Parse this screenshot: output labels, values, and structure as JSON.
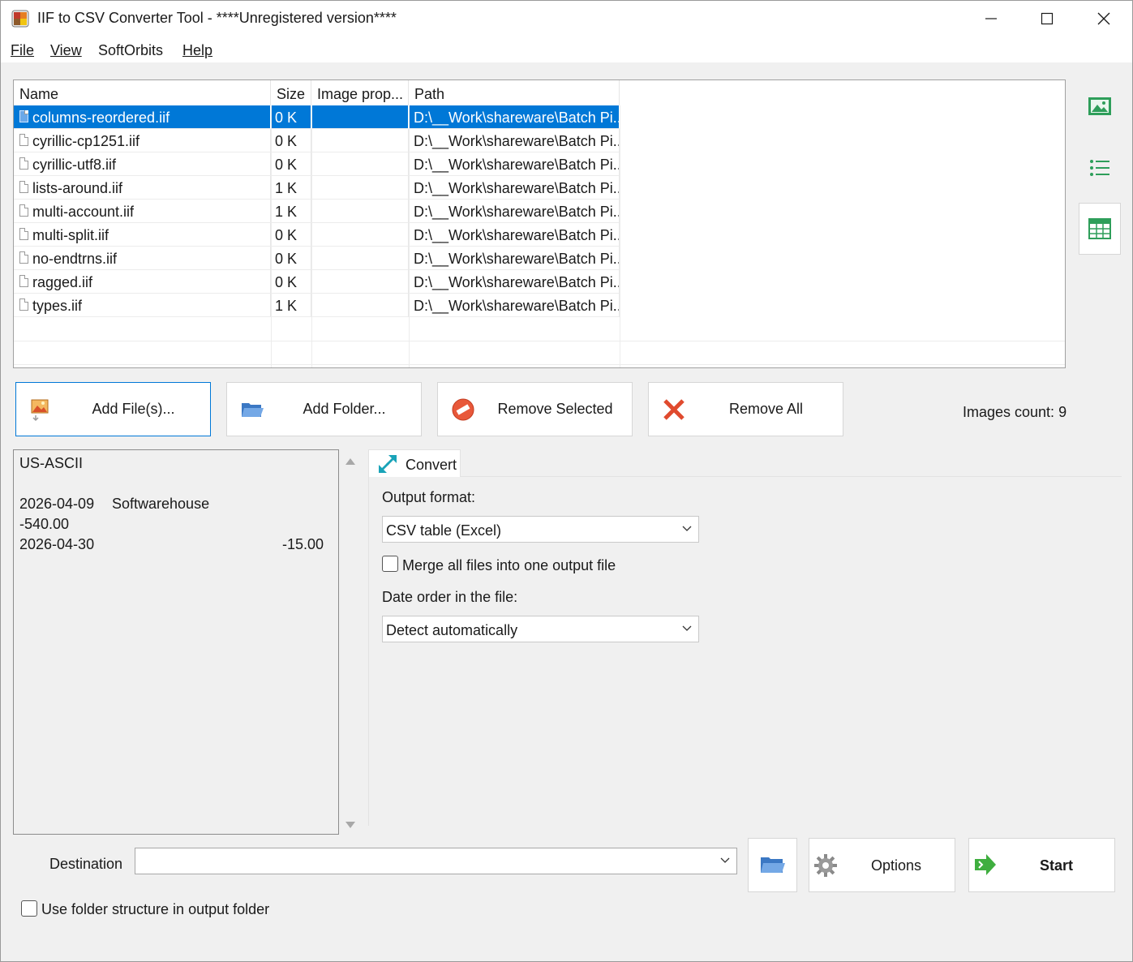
{
  "window": {
    "title": "IIF to CSV Converter Tool - ****Unregistered version****"
  },
  "menu": {
    "file": {
      "label": "File"
    },
    "view": {
      "label": "View"
    },
    "softorbits": {
      "label": "SoftOrbits"
    },
    "help": {
      "label": "Help"
    }
  },
  "filelist": {
    "columns": [
      "Name",
      "Size",
      "Image prop...",
      "Path"
    ],
    "rows": [
      {
        "name": "columns-reordered.iif",
        "size": "0 K",
        "prop": "",
        "path": "D:\\__Work\\shareware\\Batch Pi...",
        "selected": true
      },
      {
        "name": "cyrillic-cp1251.iif",
        "size": "0 K",
        "prop": "",
        "path": "D:\\__Work\\shareware\\Batch Pi..."
      },
      {
        "name": "cyrillic-utf8.iif",
        "size": "0 K",
        "prop": "",
        "path": "D:\\__Work\\shareware\\Batch Pi..."
      },
      {
        "name": "lists-around.iif",
        "size": "1 K",
        "prop": "",
        "path": "D:\\__Work\\shareware\\Batch Pi..."
      },
      {
        "name": "multi-account.iif",
        "size": "1 K",
        "prop": "",
        "path": "D:\\__Work\\shareware\\Batch Pi..."
      },
      {
        "name": "multi-split.iif",
        "size": "0 K",
        "prop": "",
        "path": "D:\\__Work\\shareware\\Batch Pi..."
      },
      {
        "name": "no-endtrns.iif",
        "size": "0 K",
        "prop": "",
        "path": "D:\\__Work\\shareware\\Batch Pi..."
      },
      {
        "name": "ragged.iif",
        "size": "0 K",
        "prop": "",
        "path": "D:\\__Work\\shareware\\Batch Pi..."
      },
      {
        "name": "types.iif",
        "size": "1 K",
        "prop": "",
        "path": "D:\\__Work\\shareware\\Batch Pi..."
      }
    ]
  },
  "actions": {
    "add_files": "Add File(s)...",
    "add_folder": "Add Folder...",
    "remove_selected": "Remove Selected",
    "remove_all": "Remove All",
    "images_count": "Images count: 9"
  },
  "preview": {
    "line1": "US-ASCII",
    "line2_date": "2026-04-09",
    "line2_name": "Softwarehouse",
    "line3": "-540.00",
    "line4_date": "2026-04-30",
    "line4_amount": "-15.00"
  },
  "convert_tab": {
    "tab_label": "Convert",
    "output_format_label": "Output format:",
    "output_format_value": "CSV table (Excel)",
    "merge_label": "Merge all files into one output file",
    "merge_checked": false,
    "date_order_label": "Date order in the file:",
    "date_order_value": "Detect automatically"
  },
  "bottom": {
    "destination_label": "Destination",
    "destination_value": "",
    "options_label": "Options",
    "start_label": "Start",
    "folder_structure_label": "Use folder structure in output folder",
    "folder_structure_checked": false
  },
  "colors": {
    "selection": "#0078d7",
    "window_bg": "#f0f0f0",
    "accent_green": "#2e9e5a"
  }
}
